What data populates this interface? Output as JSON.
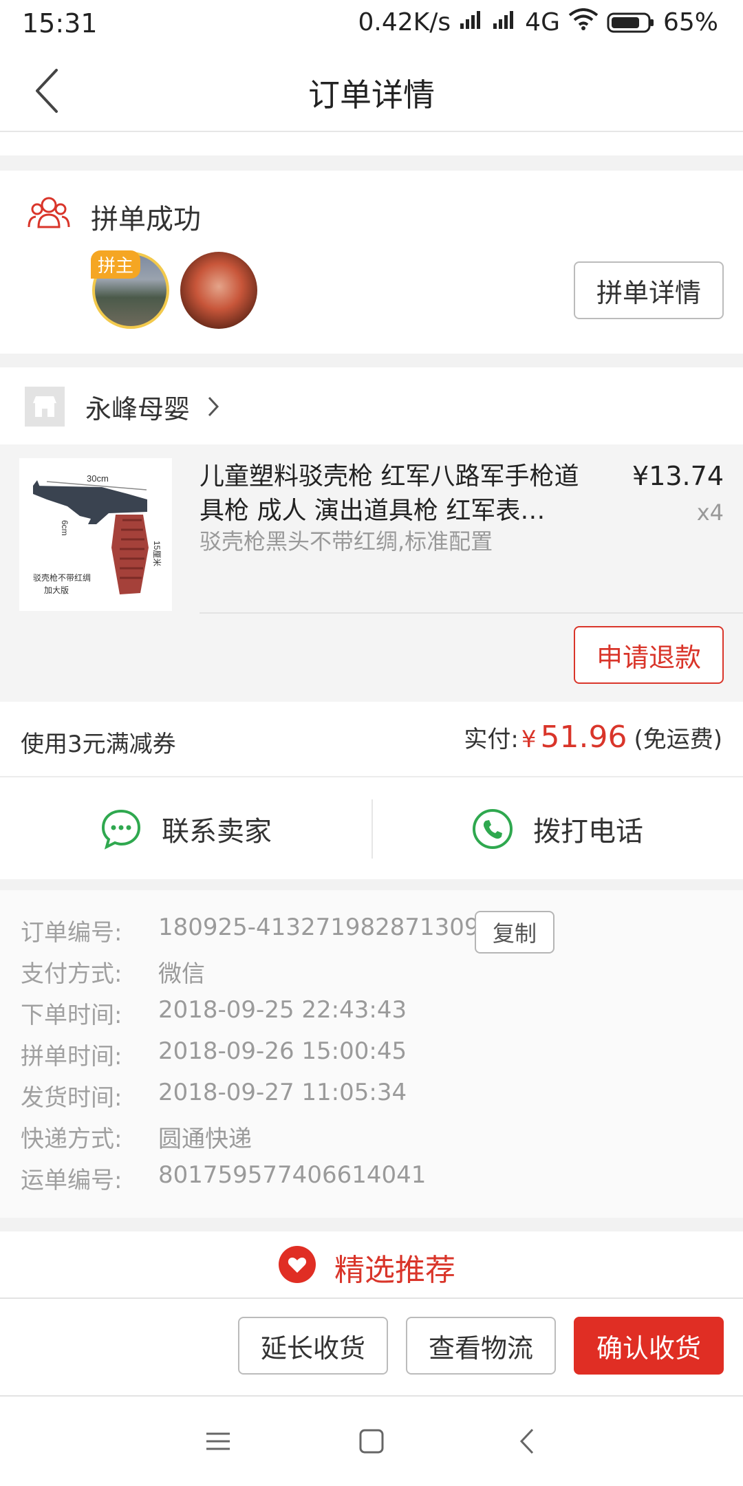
{
  "status_bar": {
    "time": "15:31",
    "speed": "0.42K/s",
    "network": "4G",
    "battery": "65%"
  },
  "header": {
    "title": "订单详情",
    "back_icon": "back-arrow-icon"
  },
  "group": {
    "title": "拼单成功",
    "leader_badge": "拼主",
    "detail_button": "拼单详情",
    "icon": "group-people-icon"
  },
  "store": {
    "name": "永峰母婴",
    "icon": "store-icon"
  },
  "product": {
    "title": "儿童塑料驳壳枪 红军八路军手枪道具枪 成人 演出道具枪 红军表…",
    "sku": "驳壳枪黑头不带红绸,标准配置",
    "price": "¥13.74",
    "quantity": "x4",
    "image_labels": {
      "width_mark": "30cm",
      "side_mark": "6cm",
      "height_mark": "15厘米",
      "caption_line1": "驳壳枪不带红绸",
      "caption_line2": "加大版"
    },
    "refund_button": "申请退款"
  },
  "payment": {
    "coupon": "使用3元满减券",
    "paid_label": "实付:",
    "currency": "¥",
    "amount": "51.96",
    "shipping_note": "(免运费)"
  },
  "contact": {
    "seller_label": "联系卖家",
    "phone_label": "拨打电话"
  },
  "order_info": {
    "copy_button": "复制",
    "rows": [
      {
        "label": "订单编号:",
        "value": "180925-413271982871309"
      },
      {
        "label": "支付方式:",
        "value": "微信"
      },
      {
        "label": "下单时间:",
        "value": "2018-09-25 22:43:43"
      },
      {
        "label": "拼单时间:",
        "value": "2018-09-26 15:00:45"
      },
      {
        "label": "发货时间:",
        "value": "2018-09-27 11:05:34"
      },
      {
        "label": "快递方式:",
        "value": "圆通快递"
      },
      {
        "label": "运单编号:",
        "value": "801759577406614041"
      }
    ]
  },
  "recommend": {
    "label": "精选推荐",
    "icon": "heart-icon"
  },
  "actions": {
    "extend": "延长收货",
    "logistics": "查看物流",
    "confirm": "确认收货"
  },
  "colors": {
    "accent": "#e02e24",
    "accent_text": "#d9352a",
    "green": "#2fa84f",
    "badge": "#f5a623"
  }
}
